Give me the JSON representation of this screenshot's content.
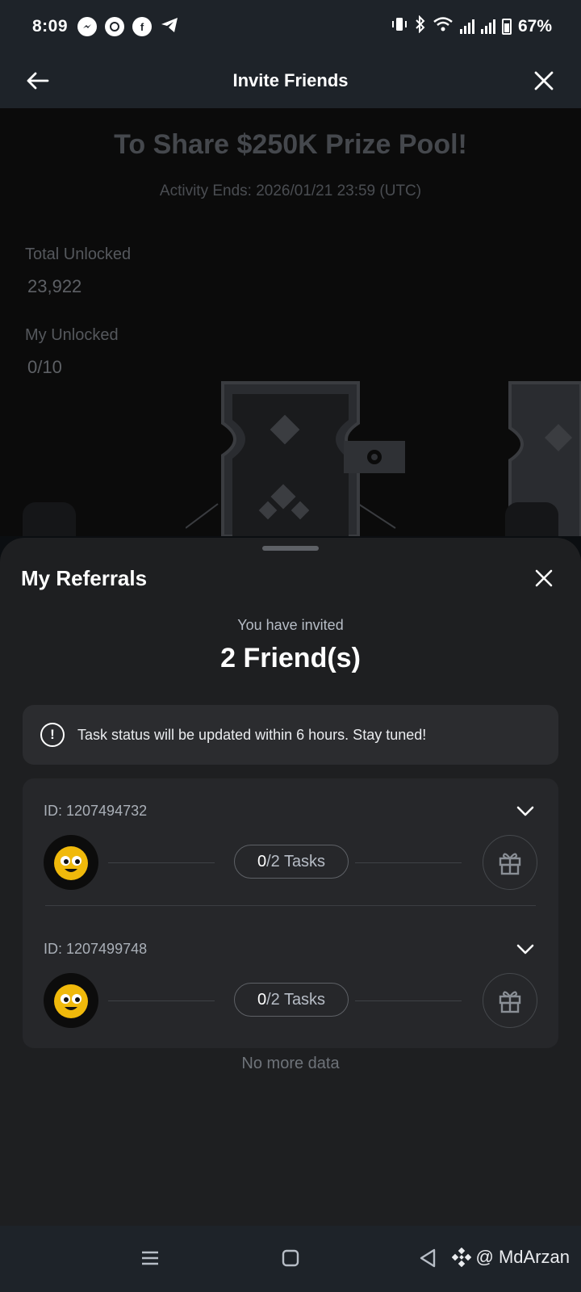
{
  "status_bar": {
    "time": "8:09",
    "battery": "67%",
    "apps": [
      "messenger-icon",
      "whatsapp-icon",
      "facebook-icon",
      "telegram-icon"
    ]
  },
  "header": {
    "title": "Invite Friends"
  },
  "background": {
    "headline": "To Share $250K Prize Pool!",
    "activity_ends": "Activity Ends: 2026/01/21 23:59 (UTC)",
    "total_unlocked_label": "Total Unlocked",
    "total_unlocked_value": "23,922",
    "my_unlocked_label": "My Unlocked",
    "my_unlocked_value": "0/10"
  },
  "sheet": {
    "title": "My Referrals",
    "invited_label": "You have invited",
    "invited_count": "2 Friend(s)",
    "notice": "Task status will be updated within 6 hours. Stay tuned!",
    "referrals": [
      {
        "id": "ID: 1207494732",
        "tasks_done": "0",
        "tasks_total": "/2 Tasks"
      },
      {
        "id": "ID: 1207499748",
        "tasks_done": "0",
        "tasks_total": "/2 Tasks"
      }
    ],
    "no_more": "No more data"
  },
  "watermark": "@ MdArzan",
  "colors": {
    "bg": "#0b0e11",
    "sheet": "#1e1f21",
    "card": "#26272a",
    "accent_yellow": "#f0b90b",
    "text_primary": "#ffffff",
    "text_secondary": "#b7bdc6"
  }
}
